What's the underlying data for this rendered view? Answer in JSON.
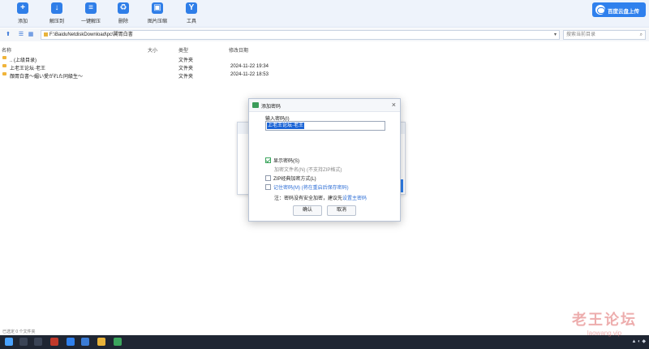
{
  "toolbar": {
    "add": "添加",
    "extract": "解压到",
    "one_click": "一键解压",
    "delete": "删除",
    "image_convert": "图片压缩",
    "tools": "工具",
    "cloud_upload": "百度云盘上传"
  },
  "addressbar": {
    "path": "F:\\BaiduNetdiskDownload\\pc\\閣胃白書",
    "search_placeholder": "搜索当前目录"
  },
  "filelist": {
    "columns": [
      "名称",
      "大小",
      "类型",
      "修改日期"
    ],
    "rows": [
      {
        "name": ".. (上级目录)",
        "size": "",
        "type": "文件夹",
        "date": ""
      },
      {
        "name": "上老王论坛·老王",
        "size": "",
        "type": "文件夹",
        "date": "2024-11-22 19:34"
      },
      {
        "name": "顔胃白書～媚い愛がれた同級生～",
        "size": "",
        "type": "文件夹",
        "date": "2024-11-22 18:53"
      }
    ]
  },
  "dialog": {
    "title": "添加密码",
    "input_label": "输入密码(I)",
    "password_value": "上老王论坛·老王",
    "show_password": "显示密码(S)",
    "encrypt_filename": "加密文件名(N) (不支持ZIP格式)",
    "zip_legacy": "ZIP经典加密方式(L)",
    "remember_password": "记住密码(M) (将在重启后保存密码)",
    "note_prefix": "注：密码没有安全加密，建议先",
    "note_link": "设置主密码",
    "ok": "确认",
    "cancel": "取消"
  },
  "statusbar": {
    "text": "已选定 0 个文件夹"
  },
  "watermark": {
    "line1": "老王论坛",
    "line2": "laowang.vip"
  },
  "colors": {
    "accent": "#2f80ed",
    "taskbar": "#1f2633"
  }
}
